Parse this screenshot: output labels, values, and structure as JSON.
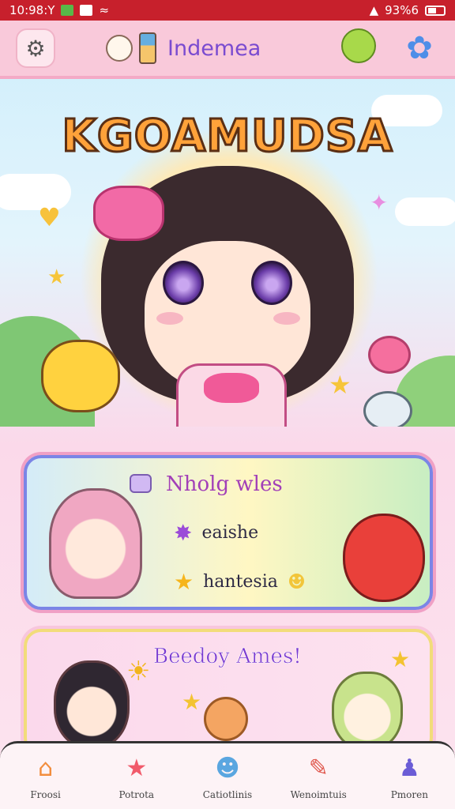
{
  "status_bar": {
    "time": "10:98:Y",
    "right_text": "93%6"
  },
  "header": {
    "title": "Indemea",
    "icons": {
      "settings": "settings-icon",
      "mascot": "mascot-icon",
      "tower": "tower-icon",
      "blob": "green-blob-icon",
      "flower": "flower-icon"
    }
  },
  "hero": {
    "title": "KGOAMUDSA"
  },
  "card1": {
    "title": "Nholg wles",
    "rows": [
      {
        "label": "eaishe",
        "icon": "sparkle-icon"
      },
      {
        "label": "hantesia",
        "icon": "star-icon"
      }
    ]
  },
  "card2": {
    "title": "Beedoy Ames!"
  },
  "bottom_nav": [
    {
      "label": "Froosi",
      "icon": "house-icon"
    },
    {
      "label": "Potrota",
      "icon": "star-wand-icon"
    },
    {
      "label": "Catiotlinis",
      "icon": "buddy-icon"
    },
    {
      "label": "Wenoimtuis",
      "icon": "tool-icon"
    },
    {
      "label": "Pmoren",
      "icon": "profile-icon"
    }
  ],
  "colors": {
    "status_bar": "#c7202c",
    "header": "#f9c9da",
    "accent_purple": "#7a4bd0",
    "title_orange": "#ffa23a"
  }
}
